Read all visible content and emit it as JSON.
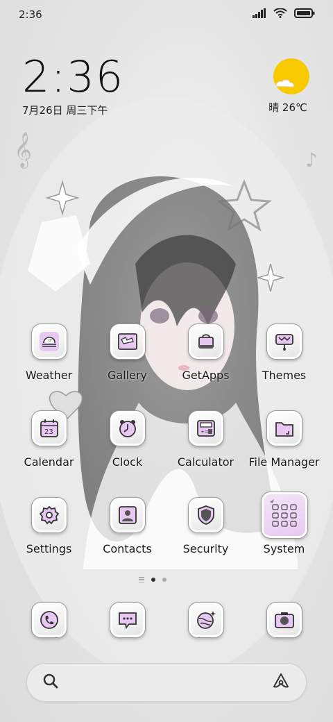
{
  "status_bar": {
    "time": "2:36",
    "icons": [
      "signal-icon",
      "wifi-icon",
      "battery-icon"
    ]
  },
  "clock_widget": {
    "time": "2:36",
    "date": "7月26日 周三下午"
  },
  "weather_widget": {
    "icon": "sun-cloud-icon",
    "text": "晴 26℃",
    "sun_color": "#f9c900"
  },
  "apps": [
    {
      "label": "Weather",
      "icon": "weather-icon"
    },
    {
      "label": "Gallery",
      "icon": "gallery-icon"
    },
    {
      "label": "GetApps",
      "icon": "getapps-icon"
    },
    {
      "label": "Themes",
      "icon": "themes-icon"
    },
    {
      "label": "Calendar",
      "icon": "calendar-icon",
      "badge_text": "23"
    },
    {
      "label": "Clock",
      "icon": "clock-icon"
    },
    {
      "label": "Calculator",
      "icon": "calculator-icon"
    },
    {
      "label": "File Manager",
      "icon": "folder-icon"
    },
    {
      "label": "Settings",
      "icon": "gear-icon"
    },
    {
      "label": "Contacts",
      "icon": "contacts-icon"
    },
    {
      "label": "Security",
      "icon": "shield-icon"
    },
    {
      "label": "System",
      "icon": "system-folder-icon"
    }
  ],
  "page_indicator": {
    "pages": 2,
    "active": 1
  },
  "dock": [
    {
      "icon": "phone-icon"
    },
    {
      "icon": "messages-icon"
    },
    {
      "icon": "browser-icon"
    },
    {
      "icon": "camera-icon"
    }
  ],
  "search_bar": {
    "left_icon": "search-icon",
    "right_icon": "assistant-icon"
  },
  "theme": {
    "icon_accent": "#e8c8f2",
    "icon_stroke": "#333333"
  }
}
